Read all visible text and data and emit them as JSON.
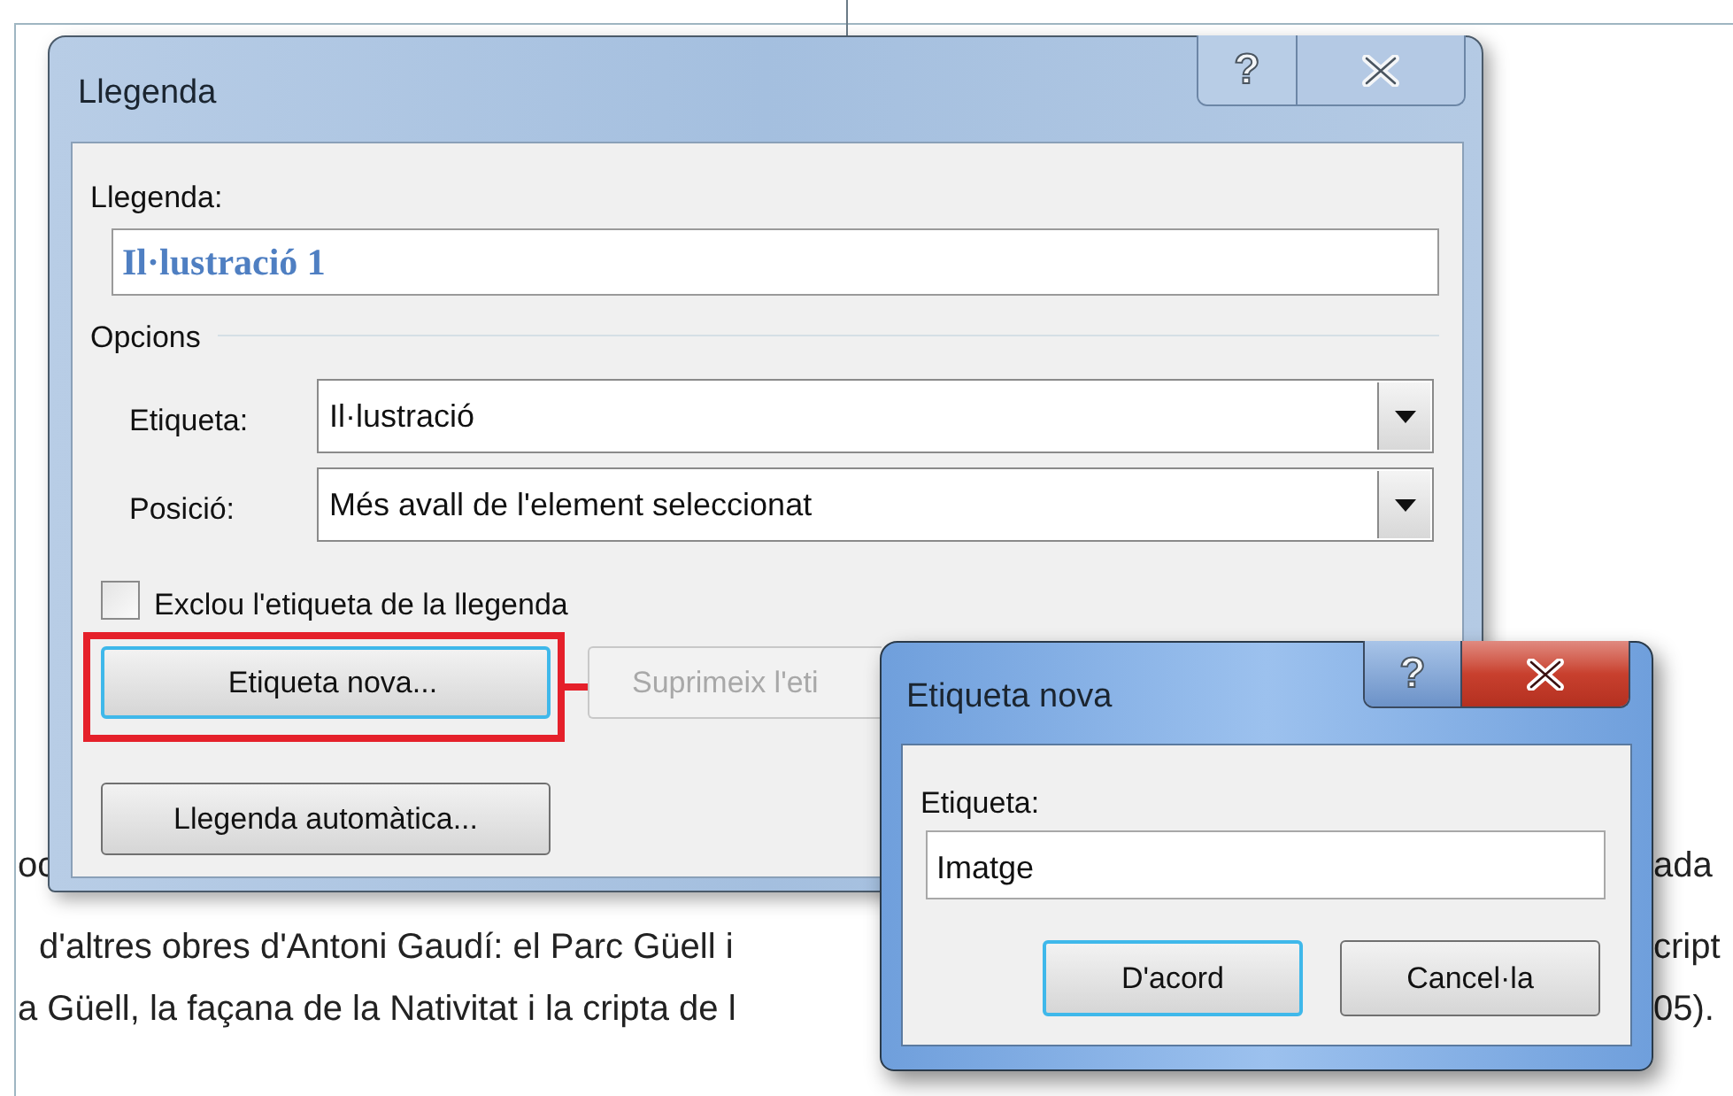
{
  "document": {
    "lines": [
      {
        "left": "oc",
        "right": "ada"
      },
      {
        "left": "d'altres obres d'Antoni Gaudí: el Parc Güell i",
        "right": "cript"
      },
      {
        "left": "a Güell, la façana de la Nativitat i la cripta de l",
        "right": "05)."
      }
    ]
  },
  "caption_dialog": {
    "title": "Llegenda",
    "help": "?",
    "caption_label": "Llegenda:",
    "caption_value": "Il·lustració 1",
    "options_heading": "Opcions",
    "label_label": "Etiqueta:",
    "label_value": "Il·lustració",
    "position_label": "Posició:",
    "position_value": "Més avall de l'element seleccionat",
    "exclude": {
      "label": "Exclou l'etiqueta de la llegenda",
      "checked": false
    },
    "buttons": [
      {
        "label": "Etiqueta nova...",
        "focused": true,
        "highlighted": true,
        "disabled": false
      },
      {
        "label": "Suprimeix l'eti",
        "focused": false,
        "highlighted": false,
        "disabled": true
      }
    ],
    "autocaption_button": "Llegenda automàtica..."
  },
  "new_label_dialog": {
    "title": "Etiqueta nova",
    "help": "?",
    "label": "Etiqueta:",
    "value": "Imatge",
    "buttons": [
      {
        "label": "D'acord",
        "default": true
      },
      {
        "label": "Cancel·la",
        "default": false
      }
    ]
  }
}
